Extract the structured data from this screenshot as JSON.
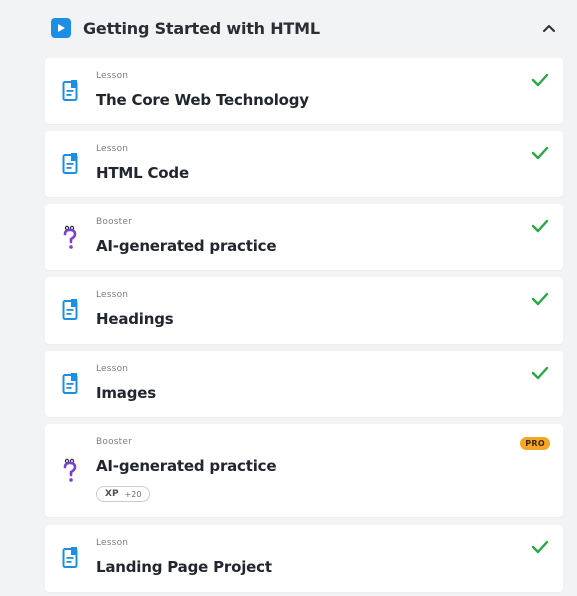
{
  "section": {
    "title": "Getting Started with HTML",
    "icon": "play-icon",
    "accent": "#1a8fe3"
  },
  "items": [
    {
      "kind": "Lesson",
      "title": "The Core Web Technology",
      "icon": "lesson-doc-icon",
      "completed": true
    },
    {
      "kind": "Lesson",
      "title": "HTML Code",
      "icon": "lesson-doc-icon",
      "completed": true
    },
    {
      "kind": "Booster",
      "title": "AI-generated practice",
      "icon": "booster-question-icon",
      "completed": true
    },
    {
      "kind": "Lesson",
      "title": "Headings",
      "icon": "lesson-doc-icon",
      "completed": true
    },
    {
      "kind": "Lesson",
      "title": "Images",
      "icon": "lesson-doc-icon",
      "completed": true
    },
    {
      "kind": "Booster",
      "title": "AI-generated practice",
      "icon": "booster-question-icon",
      "completed": false,
      "badge": "PRO",
      "xp_label": "XP",
      "xp_amount": "+20"
    },
    {
      "kind": "Lesson",
      "title": "Landing Page Project",
      "icon": "lesson-doc-icon",
      "completed": true
    }
  ],
  "colors": {
    "check": "#28a745",
    "lesson_icon": "#1a8fe3",
    "booster_icon": "#7b3fd6",
    "pro_badge": "#f5a623"
  }
}
